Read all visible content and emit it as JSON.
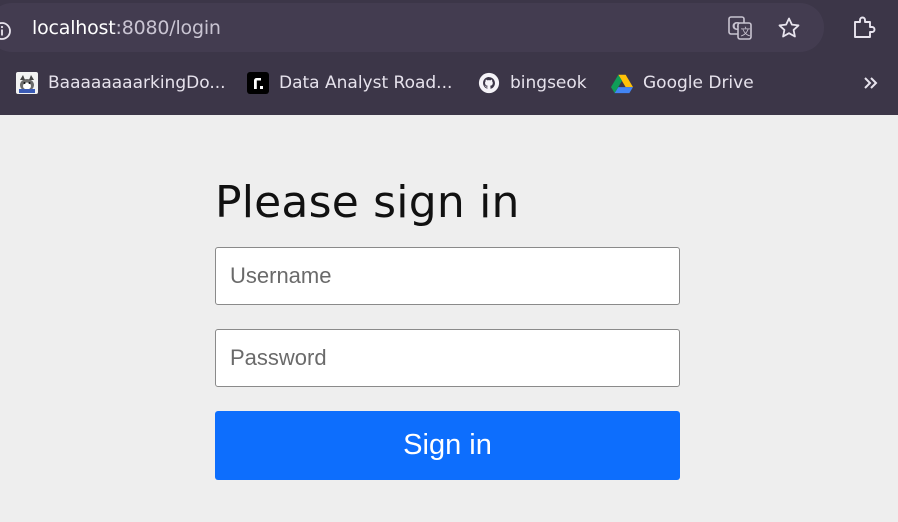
{
  "browser": {
    "url_host": "localhost",
    "url_path": ":8080/login",
    "bookmarks": [
      {
        "label": "BaaaaaaaarkingDo...",
        "icon": "dog-avatar-icon"
      },
      {
        "label": "Data Analyst Road...",
        "icon": "roadmap-logo-icon"
      },
      {
        "label": "bingseok",
        "icon": "github-icon"
      },
      {
        "label": "Google Drive",
        "icon": "google-drive-icon"
      }
    ],
    "colors": {
      "chrome_bg": "#3c3648",
      "urlbar_bg": "#433c50"
    }
  },
  "page": {
    "title": "Please sign in",
    "username_placeholder": "Username",
    "password_placeholder": "Password",
    "signin_label": "Sign in",
    "colors": {
      "primary": "#0d6efd",
      "background": "#eeeeee"
    }
  }
}
